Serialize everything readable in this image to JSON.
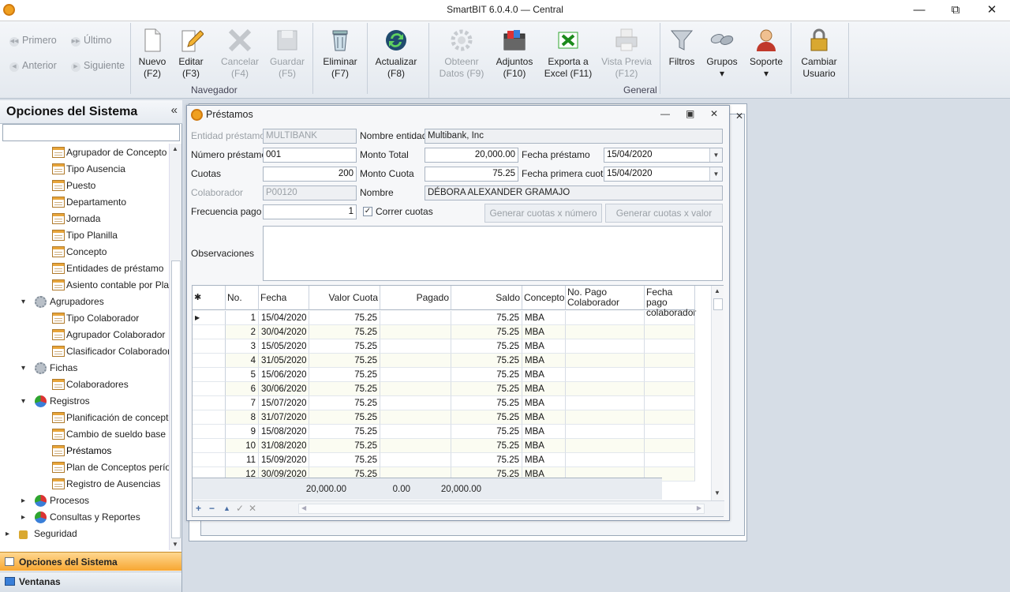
{
  "app": {
    "title": "SmartBIT 6.0.4.0 — Central"
  },
  "ribbon": {
    "nav_small": {
      "first": "Primero",
      "last": "Último",
      "prev": "Anterior",
      "next": "Siguiente"
    },
    "buttons": [
      {
        "line1": "Nuevo",
        "line2": "(F2)",
        "enabled": true,
        "icon": "new-document-icon"
      },
      {
        "line1": "Editar",
        "line2": "(F3)",
        "enabled": true,
        "icon": "edit-pencil-icon"
      },
      {
        "line1": "Cancelar",
        "line2": "(F4)",
        "enabled": false,
        "icon": "cancel-x-icon"
      },
      {
        "line1": "Guardar",
        "line2": "(F5)",
        "enabled": false,
        "icon": "save-disk-icon"
      },
      {
        "line1": "Eliminar",
        "line2": "(F7)",
        "enabled": true,
        "icon": "trash-icon"
      },
      {
        "line1": "Actualizar",
        "line2": "(F8)",
        "enabled": true,
        "icon": "refresh-icon"
      },
      {
        "line1": "Obteenr",
        "line2": "Datos (F9)",
        "enabled": false,
        "icon": "gear-data-icon"
      },
      {
        "line1": "Adjuntos",
        "line2": "(F10)",
        "enabled": true,
        "icon": "attachments-icon"
      },
      {
        "line1": "Exporta a",
        "line2": "Excel (F11)",
        "enabled": true,
        "icon": "excel-export-icon"
      },
      {
        "line1": "Vista Previa",
        "line2": "(F12)",
        "enabled": false,
        "icon": "print-preview-icon"
      },
      {
        "line1": "Filtros",
        "line2": "",
        "enabled": true,
        "icon": "filter-funnel-icon"
      },
      {
        "line1": "Grupos",
        "line2": "▾",
        "enabled": true,
        "icon": "groups-icon"
      },
      {
        "line1": "Soporte",
        "line2": "▾",
        "enabled": true,
        "icon": "support-person-icon"
      },
      {
        "line1": "Cambiar",
        "line2": "Usuario",
        "enabled": true,
        "icon": "lock-user-icon"
      }
    ],
    "groups": {
      "navegador": "Navegador",
      "general": "General"
    }
  },
  "left_panel": {
    "title": "Opciones del Sistema",
    "tree": [
      {
        "label": "Agrupador de Concepto",
        "type": "form",
        "level": 2
      },
      {
        "label": "Tipo Ausencia",
        "type": "form",
        "level": 2
      },
      {
        "label": "Puesto",
        "type": "form",
        "level": 2
      },
      {
        "label": "Departamento",
        "type": "form",
        "level": 2
      },
      {
        "label": "Jornada",
        "type": "form",
        "level": 2
      },
      {
        "label": "Tipo Planilla",
        "type": "form",
        "level": 2
      },
      {
        "label": "Concepto",
        "type": "form",
        "level": 2
      },
      {
        "label": "Entidades de préstamo",
        "type": "form",
        "level": 2
      },
      {
        "label": "Asiento contable por Planti",
        "type": "form",
        "level": 2
      },
      {
        "label": "Agrupadores",
        "type": "folder",
        "level": 1,
        "caret": "▾",
        "icon": "gear-group-icon"
      },
      {
        "label": "Tipo Colaborador",
        "type": "form",
        "level": 2
      },
      {
        "label": "Agrupador Colaborador",
        "type": "form",
        "level": 2
      },
      {
        "label": "Clasificador Colaborador",
        "type": "form",
        "level": 2
      },
      {
        "label": "Fichas",
        "type": "folder",
        "level": 1,
        "caret": "▾",
        "icon": "gears-icon"
      },
      {
        "label": "Colaboradores",
        "type": "form",
        "level": 2
      },
      {
        "label": "Registros",
        "type": "folder",
        "level": 1,
        "caret": "▾",
        "icon": "pie-chart-icon"
      },
      {
        "label": "Planificación de conceptos",
        "type": "form",
        "level": 2
      },
      {
        "label": "Cambio de sueldo base",
        "type": "form",
        "level": 2
      },
      {
        "label": "Préstamos",
        "type": "form",
        "level": 2,
        "selected": true
      },
      {
        "label": "Plan de Conceptos período",
        "type": "form",
        "level": 2
      },
      {
        "label": "Registro de Ausencias",
        "type": "form",
        "level": 2
      },
      {
        "label": "Procesos",
        "type": "folder",
        "level": 1,
        "caret": "▸",
        "icon": "pie-chart-icon"
      },
      {
        "label": "Consultas y Reportes",
        "type": "folder",
        "level": 1,
        "caret": "▸",
        "icon": "pie-chart-icon"
      },
      {
        "label": "Seguridad",
        "type": "folder",
        "level": 0,
        "caret": "▸",
        "icon": "lock-icon"
      }
    ],
    "bottom": {
      "options": "Opciones del Sistema",
      "windows": "Ventanas"
    }
  },
  "dialog": {
    "title": "Préstamos",
    "labels": {
      "entidad": "Entidad préstamo",
      "nombre_entidad": "Nombre entidad",
      "numero": "Número préstamo",
      "monto_total": "Monto Total",
      "fecha_prestamo": "Fecha préstamo",
      "cuotas": "Cuotas",
      "monto_cuota": "Monto Cuota",
      "fecha_primera": "Fecha primera cuota",
      "colaborador": "Colaborador",
      "nombre": "Nombre",
      "frecuencia": "Frecuencia pago",
      "correr": "Correr cuotas",
      "observaciones": "Observaciones"
    },
    "values": {
      "entidad": "MULTIBANK",
      "nombre_entidad": "Multibank, Inc",
      "numero": "001",
      "monto_total": "20,000.00",
      "fecha_prestamo": "15/04/2020",
      "cuotas": "200",
      "monto_cuota": "75.25",
      "fecha_primera": "15/04/2020",
      "colaborador": "P00120",
      "nombre": "DÉBORA ALEXANDER GRAMAJO",
      "frecuencia": "1",
      "correr_checked": true,
      "observaciones": ""
    },
    "buttons": {
      "gen_num": "Generar cuotas x número",
      "gen_val": "Generar cuotas x valor"
    },
    "grid": {
      "columns": [
        "No.",
        "Fecha",
        "Valor Cuota",
        "Pagado",
        "Saldo",
        "Concepto",
        "No. Pago Colaborador",
        "Fecha pago colaborador"
      ],
      "rows": [
        [
          "1",
          "15/04/2020",
          "75.25",
          "",
          "75.25",
          "MBA",
          "",
          ""
        ],
        [
          "2",
          "30/04/2020",
          "75.25",
          "",
          "75.25",
          "MBA",
          "",
          ""
        ],
        [
          "3",
          "15/05/2020",
          "75.25",
          "",
          "75.25",
          "MBA",
          "",
          ""
        ],
        [
          "4",
          "31/05/2020",
          "75.25",
          "",
          "75.25",
          "MBA",
          "",
          ""
        ],
        [
          "5",
          "15/06/2020",
          "75.25",
          "",
          "75.25",
          "MBA",
          "",
          ""
        ],
        [
          "6",
          "30/06/2020",
          "75.25",
          "",
          "75.25",
          "MBA",
          "",
          ""
        ],
        [
          "7",
          "15/07/2020",
          "75.25",
          "",
          "75.25",
          "MBA",
          "",
          ""
        ],
        [
          "8",
          "31/07/2020",
          "75.25",
          "",
          "75.25",
          "MBA",
          "",
          ""
        ],
        [
          "9",
          "15/08/2020",
          "75.25",
          "",
          "75.25",
          "MBA",
          "",
          ""
        ],
        [
          "10",
          "31/08/2020",
          "75.25",
          "",
          "75.25",
          "MBA",
          "",
          ""
        ],
        [
          "11",
          "15/09/2020",
          "75.25",
          "",
          "75.25",
          "MBA",
          "",
          ""
        ],
        [
          "12",
          "30/09/2020",
          "75.25",
          "",
          "75.25",
          "MBA",
          "",
          ""
        ]
      ],
      "footer": {
        "valor": "20,000.00",
        "pagado": "0.00",
        "saldo": "20,000.00"
      }
    }
  }
}
